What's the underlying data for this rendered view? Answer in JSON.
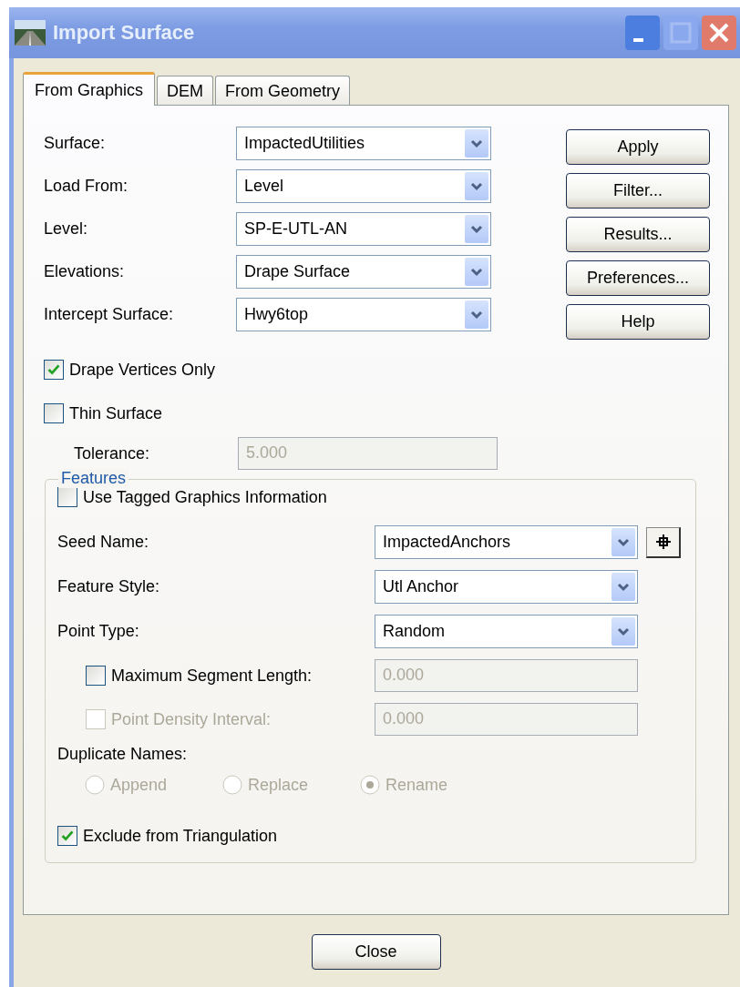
{
  "window": {
    "title": "Import Surface"
  },
  "tabs": [
    {
      "label": "From Graphics",
      "selected": true
    },
    {
      "label": "DEM",
      "selected": false
    },
    {
      "label": "From Geometry",
      "selected": false
    }
  ],
  "combos": [
    {
      "label": "Surface:",
      "value": "ImpactedUtilities"
    },
    {
      "label": "Load From:",
      "value": "Level"
    },
    {
      "label": "Level:",
      "value": "SP-E-UTL-AN"
    },
    {
      "label": "Elevations:",
      "value": "Drape Surface"
    },
    {
      "label": "Intercept Surface:",
      "value": "Hwy6top"
    }
  ],
  "buttons": [
    "Apply",
    "Filter...",
    "Results...",
    "Preferences...",
    "Help"
  ],
  "checks": [
    {
      "label": "Drape Vertices Only",
      "checked": true
    },
    {
      "label": "Thin Surface",
      "checked": false
    }
  ],
  "tolerance": {
    "label": "Tolerance:",
    "value": "5.000",
    "disabled": true
  },
  "features": {
    "title": "Features",
    "tagged": {
      "label": "Use Tagged Graphics Information",
      "checked": false
    },
    "combos": [
      {
        "label": "Seed Name:",
        "value": "ImpactedAnchors",
        "picker": true
      },
      {
        "label": "Feature Style:",
        "value": "Utl Anchor",
        "picker": false
      },
      {
        "label": "Point Type:",
        "value": "Random",
        "picker": false
      }
    ],
    "lengths": [
      {
        "label": "Maximum Segment Length:",
        "checked": false,
        "disabled": false,
        "value": "0.000",
        "field_disabled": true
      },
      {
        "label": "Point Density Interval:",
        "checked": false,
        "disabled": true,
        "value": "0.000",
        "field_disabled": true
      }
    ],
    "duplicate": {
      "label": "Duplicate Names:",
      "disabled": true,
      "options": [
        {
          "label": "Append",
          "selected": false
        },
        {
          "label": "Replace",
          "selected": false
        },
        {
          "label": "Rename",
          "selected": true
        }
      ]
    },
    "exclude": {
      "label": "Exclude from Triangulation",
      "checked": true
    }
  },
  "close": "Close"
}
